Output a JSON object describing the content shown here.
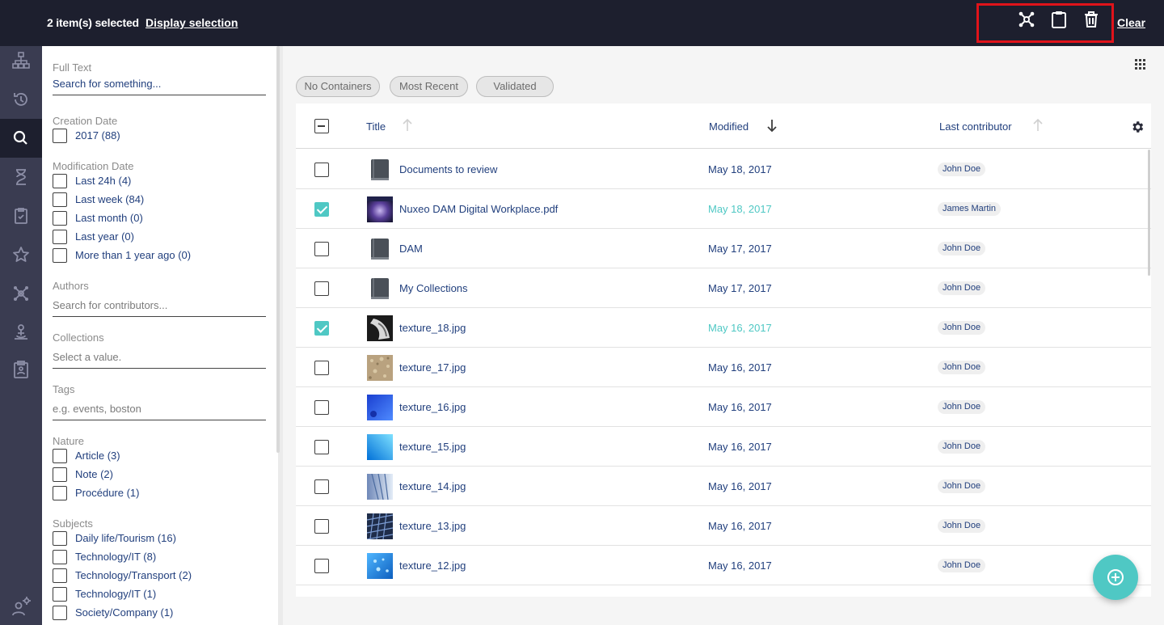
{
  "selection_bar": {
    "count_label": "2 item(s) selected",
    "display_label": "Display selection",
    "clear_label": "Clear",
    "actions": [
      "add-to-collection-icon",
      "clipboard-icon",
      "trash-icon"
    ],
    "highlight_color": "#e0131a"
  },
  "rail": {
    "items": [
      "browse-icon",
      "history-icon",
      "search-icon",
      "expired-icon",
      "tasks-icon",
      "favorites-icon",
      "collections-icon",
      "personal-workspace-icon",
      "clipboard-icon",
      "administration-icon"
    ],
    "active": "search-icon"
  },
  "filters": {
    "full_text": {
      "label": "Full Text",
      "value": "Search for something..."
    },
    "creation_date": {
      "label": "Creation Date",
      "options": [
        "2017 (88)"
      ]
    },
    "modification_date": {
      "label": "Modification Date",
      "options": [
        "Last 24h (4)",
        "Last week (84)",
        "Last month (0)",
        "Last year (0)",
        "More than 1 year ago (0)"
      ]
    },
    "authors": {
      "label": "Authors",
      "placeholder": "Search for contributors..."
    },
    "collections": {
      "label": "Collections",
      "placeholder": "Select a value."
    },
    "tags": {
      "label": "Tags",
      "placeholder": "e.g. events, boston"
    },
    "nature": {
      "label": "Nature",
      "options": [
        "Article (3)",
        "Note (2)",
        "Procédure (1)"
      ]
    },
    "subjects": {
      "label": "Subjects",
      "options": [
        "Daily life/Tourism (16)",
        "Technology/IT (8)",
        "Technology/Transport (2)",
        "Technology/IT (1)",
        "Society/Company (1)"
      ]
    }
  },
  "chips": [
    "No Containers",
    "Most Recent",
    "Validated"
  ],
  "table": {
    "columns": {
      "title": "Title",
      "modified": "Modified",
      "contributor": "Last contributor"
    },
    "rows": [
      {
        "title": "Documents to review",
        "modified": "May 18, 2017",
        "contributor": "John Doe",
        "selected": false,
        "thumb": "folder"
      },
      {
        "title": "Nuxeo DAM Digital Workplace.pdf",
        "modified": "May 18, 2017",
        "contributor": "James Martin",
        "selected": true,
        "thumb": "pdf"
      },
      {
        "title": "DAM",
        "modified": "May 17, 2017",
        "contributor": "John Doe",
        "selected": false,
        "thumb": "folder"
      },
      {
        "title": "My Collections",
        "modified": "May 17, 2017",
        "contributor": "John Doe",
        "selected": false,
        "thumb": "folder"
      },
      {
        "title": "texture_18.jpg",
        "modified": "May 16, 2017",
        "contributor": "John Doe",
        "selected": true,
        "thumb": "t18"
      },
      {
        "title": "texture_17.jpg",
        "modified": "May 16, 2017",
        "contributor": "John Doe",
        "selected": false,
        "thumb": "t17"
      },
      {
        "title": "texture_16.jpg",
        "modified": "May 16, 2017",
        "contributor": "John Doe",
        "selected": false,
        "thumb": "t16"
      },
      {
        "title": "texture_15.jpg",
        "modified": "May 16, 2017",
        "contributor": "John Doe",
        "selected": false,
        "thumb": "t15"
      },
      {
        "title": "texture_14.jpg",
        "modified": "May 16, 2017",
        "contributor": "John Doe",
        "selected": false,
        "thumb": "t14"
      },
      {
        "title": "texture_13.jpg",
        "modified": "May 16, 2017",
        "contributor": "John Doe",
        "selected": false,
        "thumb": "t13"
      },
      {
        "title": "texture_12.jpg",
        "modified": "May 16, 2017",
        "contributor": "John Doe",
        "selected": false,
        "thumb": "t12"
      }
    ]
  },
  "colors": {
    "topbar": "#1d1f2e",
    "rail": "#3a3c51",
    "accent": "#4fc8c4",
    "text": "#213f7d"
  }
}
